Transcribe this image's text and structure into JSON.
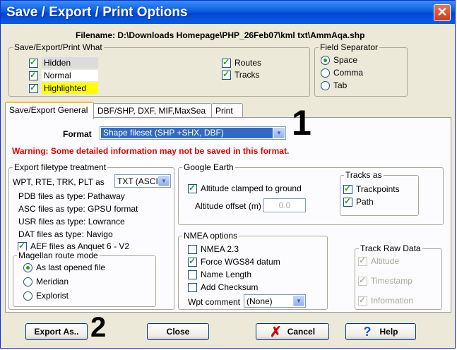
{
  "window": {
    "title": "Save / Export / Print Options",
    "close_glyph": "✕"
  },
  "filename_label": "Filename: D:\\Downloads Homepage\\PHP_26Feb07\\kml txt\\AmmAqa.shp",
  "what_group": {
    "label": "Save/Export/Print What",
    "items": [
      {
        "label": "Hidden",
        "checked": true
      },
      {
        "label": "Normal",
        "checked": true
      },
      {
        "label": "Highlighted",
        "checked": true
      },
      {
        "label": "Routes",
        "checked": true
      },
      {
        "label": "Tracks",
        "checked": true
      }
    ]
  },
  "separator_group": {
    "label": "Field Separator",
    "options": [
      {
        "label": "Space",
        "selected": true
      },
      {
        "label": "Comma",
        "selected": false
      },
      {
        "label": "Tab",
        "selected": false
      }
    ]
  },
  "tabs": [
    {
      "label": "Save/Export General",
      "active": true
    },
    {
      "label": "DBF/SHP, DXF, MIF,MaxSea",
      "active": false
    },
    {
      "label": "Print",
      "active": false
    }
  ],
  "format": {
    "label": "Format",
    "value": "Shape fileset (SHP +SHX, DBF)"
  },
  "warning": "Warning: Some detailed information may not be saved in this format.",
  "filetype_group": {
    "label": "Export filetype treatment",
    "wpt_label": "WPT, RTE, TRK, PLT as",
    "wpt_value": "TXT (ASCI",
    "lines": [
      "PDB files as type: Pathaway",
      "ASC files as type: GPSU format",
      "USR files as type: Lowrance",
      "DAT files as type: Navigo"
    ],
    "aef_label": "AEF files as Anquet 6 - V2",
    "aef_checked": true
  },
  "magellan_group": {
    "label": "Magellan route mode",
    "options": [
      {
        "label": "As last opened file",
        "selected": true
      },
      {
        "label": "Meridian",
        "selected": false
      },
      {
        "label": "Explorist",
        "selected": false
      }
    ]
  },
  "google_earth_group": {
    "label": "Google Earth",
    "altitude_clamped_label": "Altitude clamped to ground",
    "altitude_clamped_checked": true,
    "altitude_offset_label": "Altitude offset (m)",
    "altitude_offset_value": "0.0"
  },
  "tracks_as_group": {
    "label": "Tracks as",
    "items": [
      {
        "label": "Trackpoints",
        "checked": true
      },
      {
        "label": "Path",
        "checked": true
      }
    ]
  },
  "nmea_group": {
    "label": "NMEA options",
    "items": [
      {
        "label": "NMEA 2.3",
        "checked": false
      },
      {
        "label": "Force WGS84 datum",
        "checked": true
      },
      {
        "label": "Name Length",
        "checked": false
      },
      {
        "label": "Add Checksum",
        "checked": false
      }
    ],
    "wpt_comment_label": "Wpt comment",
    "wpt_comment_value": "(None)"
  },
  "raw_group": {
    "label": "Track Raw Data",
    "items": [
      {
        "label": "Altitude",
        "checked": true
      },
      {
        "label": "Timestamp",
        "checked": true
      },
      {
        "label": "Information",
        "checked": true
      }
    ]
  },
  "annotations": {
    "one": "1",
    "two": "2"
  },
  "buttons": {
    "export": "Export As..",
    "close": "Close",
    "cancel": "Cancel",
    "cancel_glyph": "✗",
    "help": "Help",
    "help_glyph": "?"
  },
  "colors": {
    "warning": "#e00000",
    "highlight": "#ffff00",
    "titlebar": "#0a5de1",
    "check": "#21a121"
  }
}
